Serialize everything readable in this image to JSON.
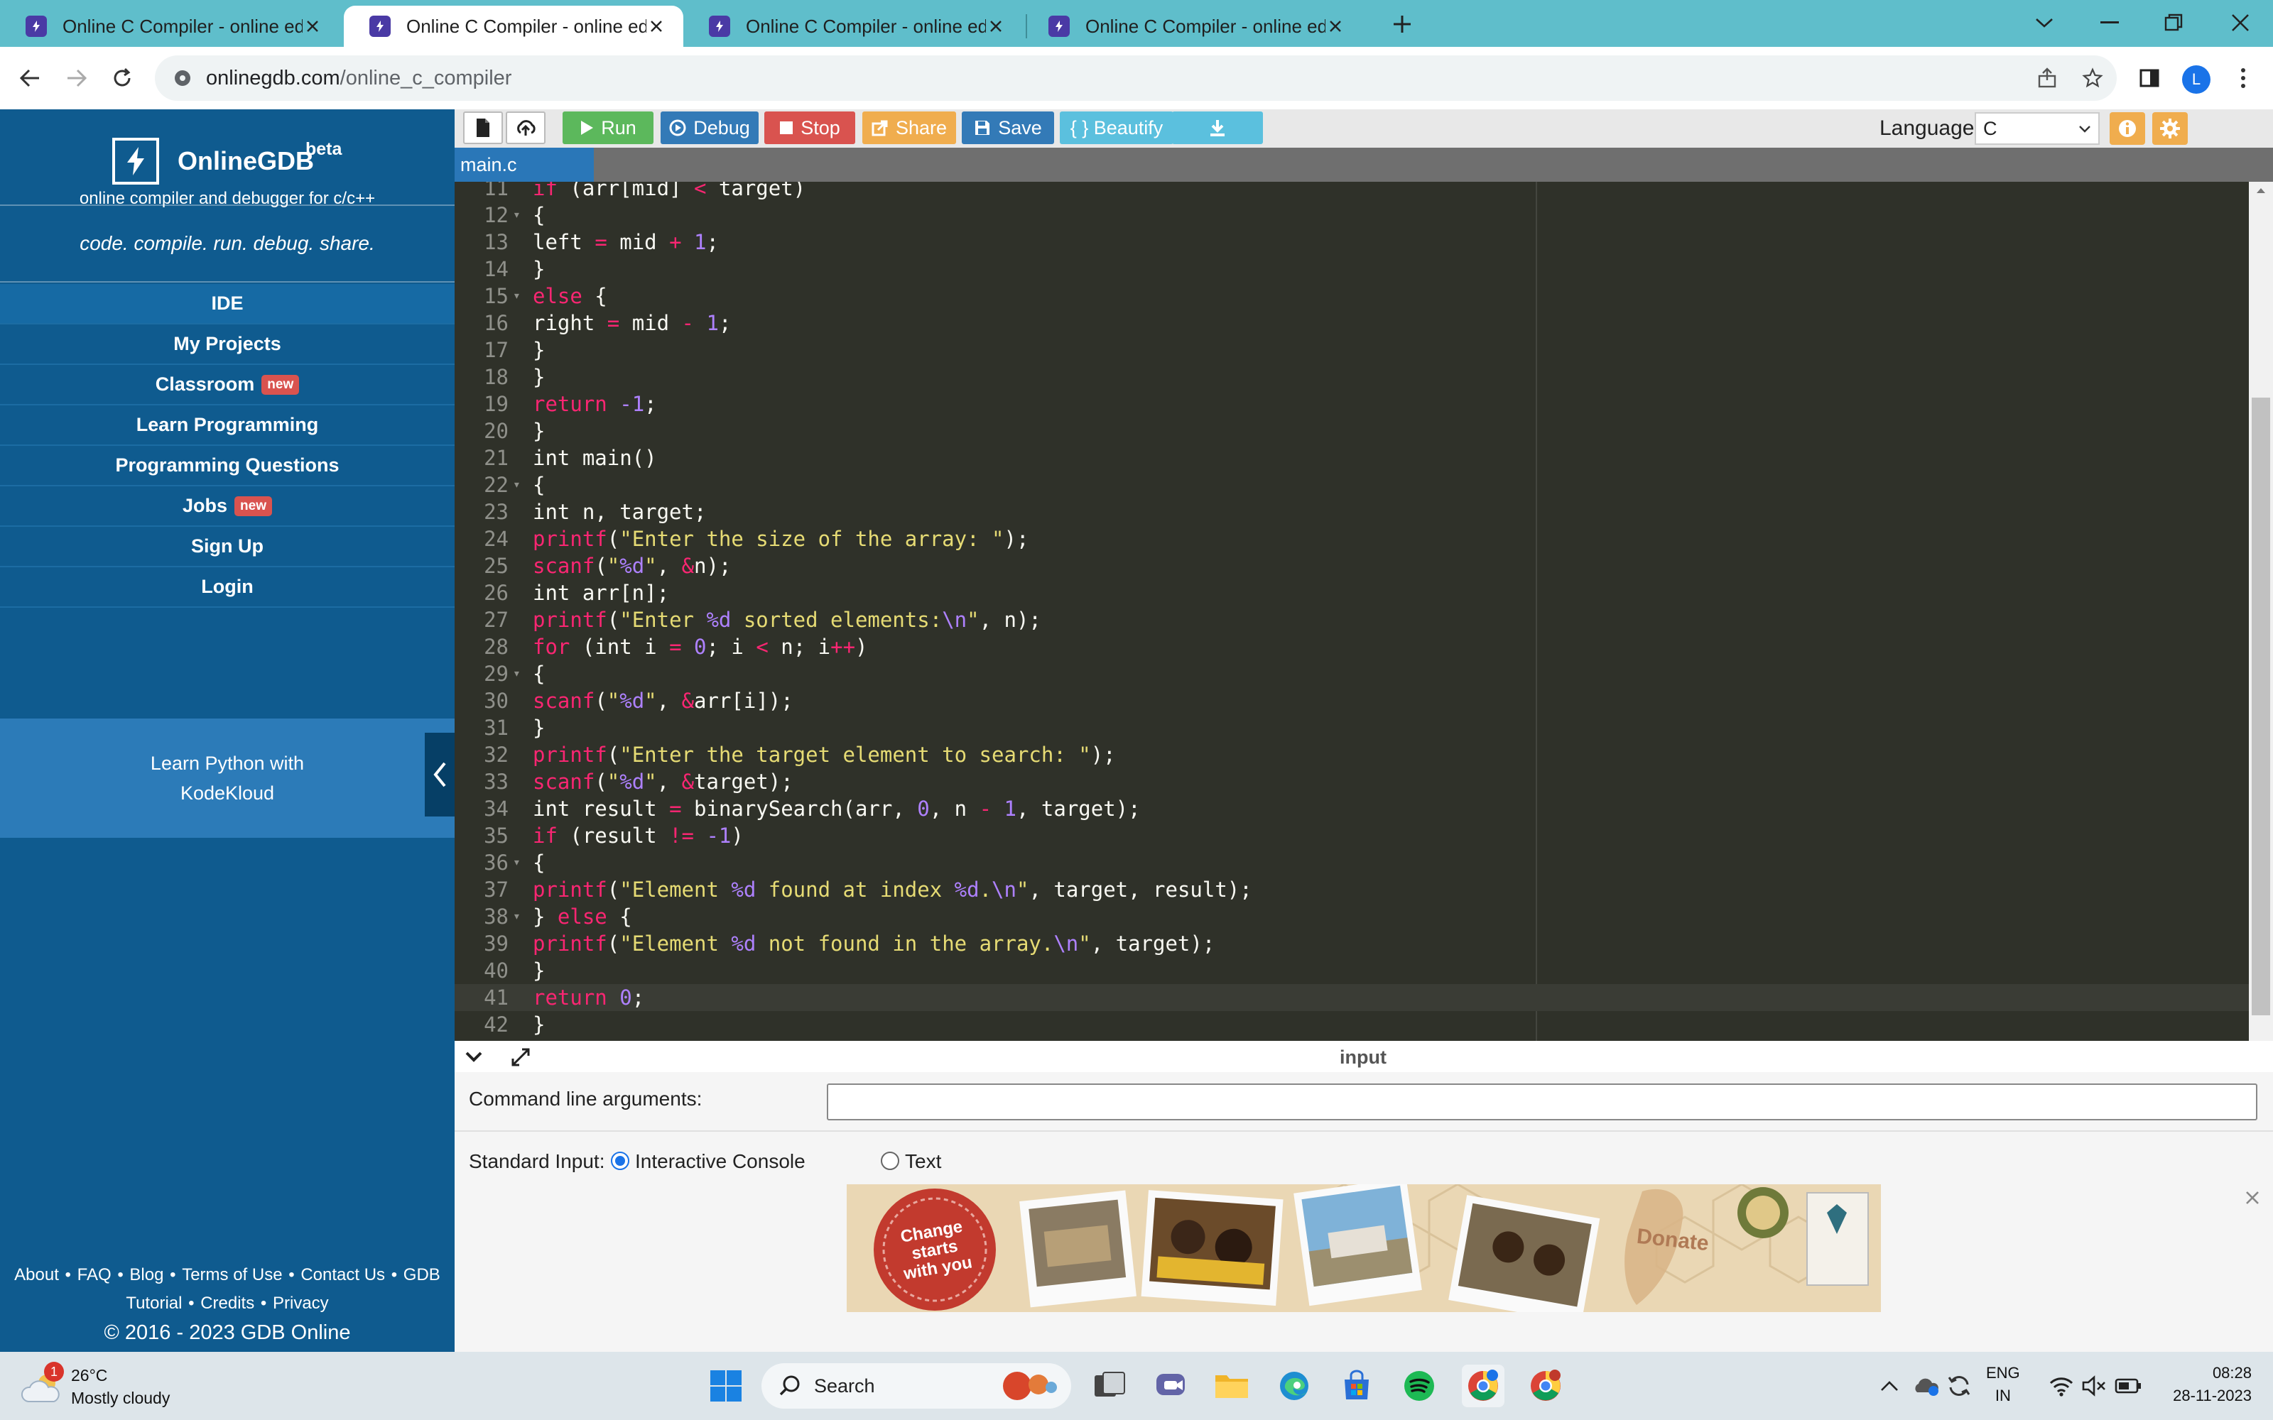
{
  "browser": {
    "tabs": [
      {
        "title": "Online C Compiler - online edito",
        "active": false
      },
      {
        "title": "Online C Compiler - online edito",
        "active": true
      },
      {
        "title": "Online C Compiler - online edito",
        "active": false
      },
      {
        "title": "Online C Compiler - online edito",
        "active": false
      }
    ],
    "url_host": "onlinegdb.com",
    "url_path": "/online_c_compiler",
    "profile_initial": "L"
  },
  "sidebar": {
    "brand_name": "OnlineGDB",
    "brand_beta": "beta",
    "brand_subtitle": "online compiler and debugger for c/c++",
    "tagline": "code. compile. run. debug. share.",
    "menu": [
      {
        "label": "IDE",
        "badge": ""
      },
      {
        "label": "My Projects",
        "badge": ""
      },
      {
        "label": "Classroom",
        "badge": "new"
      },
      {
        "label": "Learn Programming",
        "badge": ""
      },
      {
        "label": "Programming Questions",
        "badge": ""
      },
      {
        "label": "Jobs",
        "badge": "new"
      },
      {
        "label": "Sign Up",
        "badge": ""
      },
      {
        "label": "Login",
        "badge": ""
      }
    ],
    "promo_line1": "Learn Python with",
    "promo_line2": "KodeKloud",
    "footer_links_1": [
      "About",
      "FAQ",
      "Blog",
      "Terms of Use",
      "Contact Us",
      "GDB"
    ],
    "footer_links_2": [
      "Tutorial",
      "Credits",
      "Privacy"
    ],
    "copyright": "© 2016 - 2023 GDB Online"
  },
  "toolbar": {
    "run": "Run",
    "debug": "Debug",
    "stop": "Stop",
    "share": "Share",
    "save": "Save",
    "beautify": "{ } Beautify",
    "language_label": "Language",
    "language_value": "C"
  },
  "editor": {
    "file_tab": "main.c",
    "active_line": 41,
    "lines": [
      {
        "n": "11",
        "fold": false,
        "code": "if (arr[mid] < target)"
      },
      {
        "n": "12",
        "fold": true,
        "code": "{"
      },
      {
        "n": "13",
        "fold": false,
        "code": "left = mid + 1;"
      },
      {
        "n": "14",
        "fold": false,
        "code": "}"
      },
      {
        "n": "15",
        "fold": true,
        "code": "else {"
      },
      {
        "n": "16",
        "fold": false,
        "code": "right = mid - 1;"
      },
      {
        "n": "17",
        "fold": false,
        "code": "}"
      },
      {
        "n": "18",
        "fold": false,
        "code": "}"
      },
      {
        "n": "19",
        "fold": false,
        "code": "return -1;"
      },
      {
        "n": "20",
        "fold": false,
        "code": "}"
      },
      {
        "n": "21",
        "fold": false,
        "code": "int main()"
      },
      {
        "n": "22",
        "fold": true,
        "code": "{"
      },
      {
        "n": "23",
        "fold": false,
        "code": "int n, target;"
      },
      {
        "n": "24",
        "fold": false,
        "code": "printf(\"Enter the size of the array: \");"
      },
      {
        "n": "25",
        "fold": false,
        "code": "scanf(\"%d\", &n);"
      },
      {
        "n": "26",
        "fold": false,
        "code": "int arr[n];"
      },
      {
        "n": "27",
        "fold": false,
        "code": "printf(\"Enter %d sorted elements:\\n\", n);"
      },
      {
        "n": "28",
        "fold": false,
        "code": "for (int i = 0; i < n; i++)"
      },
      {
        "n": "29",
        "fold": true,
        "code": "{"
      },
      {
        "n": "30",
        "fold": false,
        "code": "scanf(\"%d\", &arr[i]);"
      },
      {
        "n": "31",
        "fold": false,
        "code": "}"
      },
      {
        "n": "32",
        "fold": false,
        "code": "printf(\"Enter the target element to search: \");"
      },
      {
        "n": "33",
        "fold": false,
        "code": "scanf(\"%d\", &target);"
      },
      {
        "n": "34",
        "fold": false,
        "code": "int result = binarySearch(arr, 0, n - 1, target);"
      },
      {
        "n": "35",
        "fold": false,
        "code": "if (result != -1)"
      },
      {
        "n": "36",
        "fold": true,
        "code": "{"
      },
      {
        "n": "37",
        "fold": false,
        "code": "printf(\"Element %d found at index %d.\\n\", target, result);"
      },
      {
        "n": "38",
        "fold": true,
        "code": "} else {"
      },
      {
        "n": "39",
        "fold": false,
        "code": "printf(\"Element %d not found in the array.\\n\", target);"
      },
      {
        "n": "40",
        "fold": false,
        "code": "}"
      },
      {
        "n": "41",
        "fold": false,
        "code": "return 0;"
      },
      {
        "n": "42",
        "fold": false,
        "code": "}"
      }
    ]
  },
  "input_panel": {
    "title": "input",
    "cla_label": "Command line arguments:",
    "cla_value": "",
    "stdin_label": "Standard Input:",
    "option_interactive": "Interactive Console",
    "option_text": "Text",
    "selected": "Interactive Console",
    "ad_text_1": "Change starts with you",
    "ad_text_2": "Donate"
  },
  "taskbar": {
    "weather_temp": "26°C",
    "weather_desc": "Mostly cloudy",
    "weather_badge": "1",
    "search_label": "Search",
    "lang_line1": "ENG",
    "lang_line2": "IN",
    "time": "08:28",
    "date": "28-11-2023"
  },
  "colors": {
    "sidebar_bg": "#0f5b8f",
    "run": "#5cb85c",
    "debug": "#337ab7",
    "stop": "#d9534f",
    "share": "#f0ad4e",
    "save": "#337ab7",
    "beautify": "#5bc0de",
    "download": "#5bc0de",
    "editor_bg": "#2f3129"
  }
}
